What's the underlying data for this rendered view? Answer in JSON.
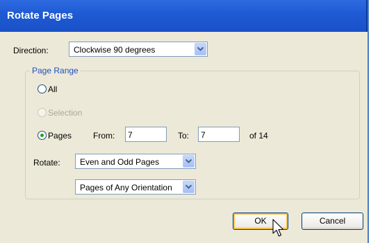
{
  "dialog": {
    "title": "Rotate Pages",
    "direction": {
      "label": "Direction:",
      "value": "Clockwise 90 degrees"
    },
    "page_range": {
      "title": "Page Range",
      "all_label": "All",
      "selection_label": "Selection",
      "pages_label": "Pages",
      "from_label": "From:",
      "from_value": "7",
      "to_label": "To:",
      "to_value": "7",
      "of_text": "of 14",
      "rotate_label": "Rotate:",
      "rotate_value": "Even and Odd Pages",
      "orientation_value": "Pages of Any Orientation",
      "selected": "Pages"
    },
    "buttons": {
      "ok": "OK",
      "cancel": "Cancel"
    }
  },
  "colors": {
    "titlebar": "#2463dc",
    "dialog_bg": "#ece9d8",
    "group_title": "#1e4fc2",
    "radio_dot": "#21a121"
  }
}
